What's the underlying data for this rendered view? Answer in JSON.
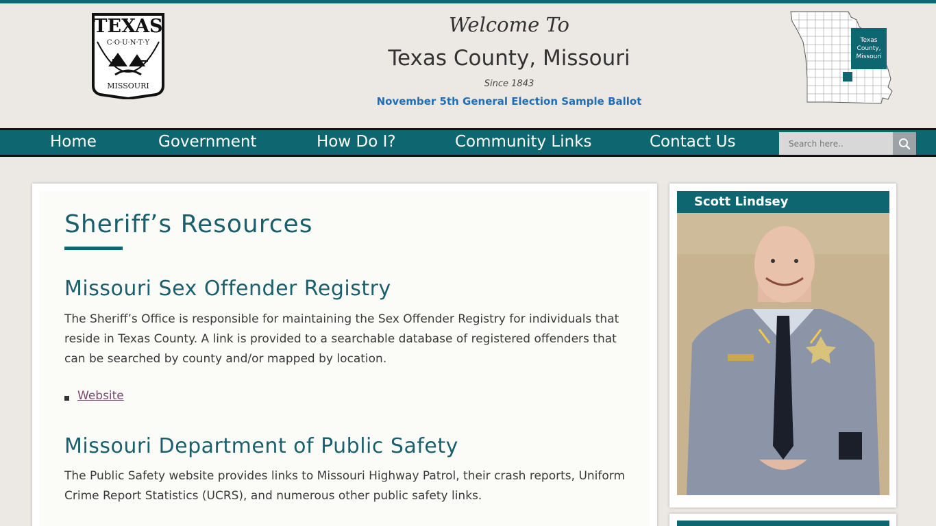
{
  "header": {
    "seal_text_top": "TEXAS",
    "seal_text_mid": "C·O·U·N·T·Y",
    "seal_text_bottom": "MISSOURI",
    "welcome": "Welcome To",
    "title": "Texas County, Missouri",
    "since": "Since 1843",
    "ballot_link": "November 5th General Election Sample Ballot",
    "map_label_line1": "Texas",
    "map_label_line2": "County,",
    "map_label_line3": "Missouri"
  },
  "nav": {
    "items": [
      {
        "label": "Home"
      },
      {
        "label": "Government"
      },
      {
        "label": "How Do I?"
      },
      {
        "label": "Community Links"
      },
      {
        "label": "Contact Us"
      }
    ],
    "search_placeholder": "Search here.."
  },
  "main": {
    "title": "Sheriff’s Resources",
    "sections": [
      {
        "heading": "Missouri Sex Offender Registry",
        "text": "The Sheriff’s Office is responsible for maintaining the Sex Offender Registry for individuals that reside in Texas County.  A link is provided to a searchable database of registered offenders that can be searched by county and/or mapped by location.",
        "link": "Website"
      },
      {
        "heading": "Missouri Department of Public Safety",
        "text": "The Public Safety website provides links to Missouri Highway Patrol, their crash reports, Uniform Crime Report Statistics (UCRS), and numerous other public safety links."
      }
    ]
  },
  "sidebar": {
    "heading": "Scott Lindsey"
  },
  "colors": {
    "brand_teal": "#0e6670",
    "heading_teal": "#1a5f6b",
    "link_blue": "#1f6fb8",
    "visited_link": "#7a4a6e",
    "background": "#ece9e5"
  }
}
